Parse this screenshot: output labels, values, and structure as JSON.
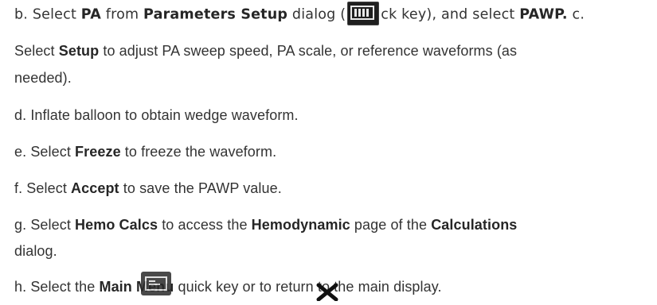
{
  "lines": [
    {
      "segments": [
        {
          "t": "b. Select ",
          "bold": false
        },
        {
          "t": "PA",
          "bold": true
        },
        {
          "t": " from ",
          "bold": false
        },
        {
          "t": "Parameters Setup",
          "bold": true
        },
        {
          "t": " dialog (",
          "bold": false
        },
        {
          "icon": "parameters-setup-icon"
        },
        {
          "t": "ck key), and select ",
          "bold": false
        },
        {
          "t": "PAWP.",
          "bold": true
        },
        {
          "t": " c.",
          "bold": false
        }
      ]
    },
    {
      "segments": [
        {
          "t": "Select ",
          "bold": false
        },
        {
          "t": "Setup",
          "bold": true
        },
        {
          "t": " to adjust PA sweep speed, PA scale, or reference waveforms (as",
          "bold": false
        }
      ]
    },
    {
      "segments": [
        {
          "t": "needed).",
          "bold": false
        }
      ]
    },
    {
      "segments": [
        {
          "t": "d. Inflate balloon to obtain wedge waveform.",
          "bold": false
        }
      ]
    },
    {
      "segments": [
        {
          "t": "e. Select ",
          "bold": false
        },
        {
          "t": "Freeze",
          "bold": true
        },
        {
          "t": " to freeze the waveform.",
          "bold": false
        }
      ]
    },
    {
      "segments": [
        {
          "t": "f. Select ",
          "bold": false
        },
        {
          "t": "Accept",
          "bold": true
        },
        {
          "t": " to save the PAWP value.",
          "bold": false
        }
      ]
    },
    {
      "segments": [
        {
          "t": "g. Select ",
          "bold": false
        },
        {
          "t": "Hemo Calcs",
          "bold": true
        },
        {
          "t": " to access the ",
          "bold": false
        },
        {
          "t": "Hemodynamic",
          "bold": true
        },
        {
          "t": " page of the ",
          "bold": false
        },
        {
          "t": "Calculations",
          "bold": true
        }
      ]
    },
    {
      "segments": [
        {
          "t": "dialog.",
          "bold": false
        }
      ]
    },
    {
      "segments": [
        {
          "t": "h. Select the ",
          "bold": false
        },
        {
          "t": "Main Menu",
          "bold": true
        },
        {
          "t": " qu",
          "bold": false
        },
        {
          "t": "ick ",
          "bold": false
        },
        {
          "t": "key or to return to the main display.",
          "bold": false
        }
      ]
    }
  ],
  "icons": {
    "parameters-setup-icon": "parameters-setup-icon",
    "main-menu-icon": "main-menu-icon",
    "close-icon": "close-icon"
  },
  "colors": {
    "text": "#333333",
    "bold": "#262626",
    "icon_bg": "#1f1f1f"
  }
}
